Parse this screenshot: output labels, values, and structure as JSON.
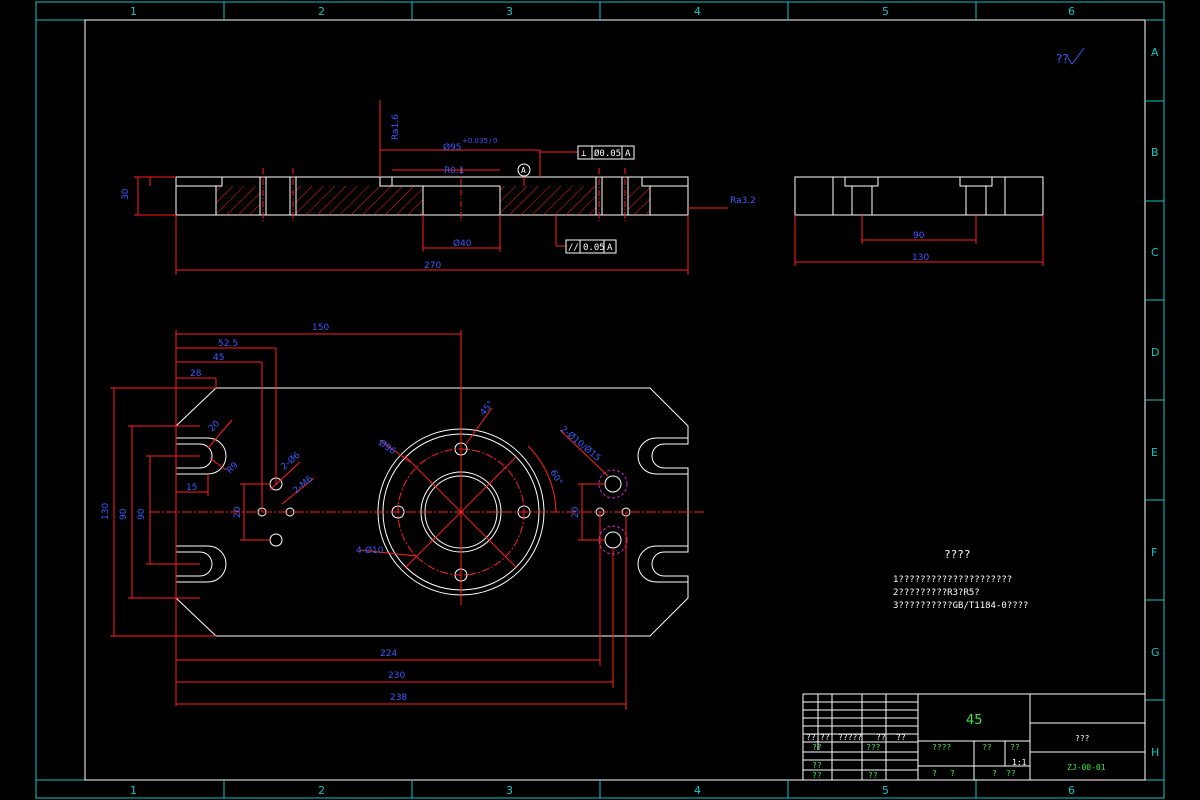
{
  "zones": {
    "columns": [
      "1",
      "2",
      "3",
      "4",
      "5",
      "6"
    ],
    "rows": [
      "A",
      "B",
      "C",
      "D",
      "E",
      "F",
      "G",
      "H"
    ]
  },
  "roughness": {
    "symbol_text": "??",
    "top_right": "??"
  },
  "front_view": {
    "dims": {
      "height": "30",
      "overall": "270",
      "bore": "Ø40",
      "bore_spec": "Ø95",
      "bore_tol": "+0.035 / 0",
      "depth_note": "R0.1",
      "surface_note": "Ra1.6",
      "flatness_note": "Ra3.2"
    },
    "datum": "A",
    "fcf_perp": {
      "sym": "⊥",
      "tol": "Ø0.05",
      "datum": "A"
    },
    "fcf_par": {
      "sym": "//",
      "tol": "0.05",
      "datum": "A"
    }
  },
  "side_view": {
    "dims": {
      "inner": "90",
      "overall": "130"
    }
  },
  "top_view": {
    "dims": {
      "d150": "150",
      "d52": "52.5",
      "d45": "45",
      "d28": "28",
      "d15": "15",
      "d20": "20",
      "r_slot": "R9",
      "h130": "130",
      "h90a": "90",
      "h90b": "90",
      "h20": "20",
      "h20b": "20",
      "d224": "224",
      "d230": "230",
      "d238": "238",
      "holes_small": "2-Ø6",
      "holes_m6": "2-M6",
      "pcd": "Ø96",
      "holes_big": "4-Ø10",
      "angle": "45°",
      "counterbore": "2-Ø10/Ø15",
      "ang2": "60°"
    }
  },
  "tech_req": {
    "title": "????",
    "lines": [
      "1?????????????????????",
      "2?????????R3?R5?",
      "3??????????GB/T1184-0????"
    ]
  },
  "title_block": {
    "material": "45",
    "name": "???",
    "drawing_no": "ZJ-00-01",
    "ratio": "1:1",
    "left_rows": [
      [
        "??",
        "??",
        "?????",
        "??",
        "??"
      ],
      [
        "??",
        "",
        "???",
        "",
        ""
      ],
      [
        "??",
        "",
        "",
        "",
        ""
      ],
      [
        "??",
        "",
        "??",
        "",
        ""
      ]
    ],
    "mid_row": [
      "????",
      "??",
      "??"
    ],
    "bottom_row": [
      "?",
      "?",
      "?",
      "??"
    ]
  },
  "colors": {
    "border": "#13c6c6",
    "part": "#ffffff",
    "dim_line": "#ff2020",
    "dim_text": "#3c5cff",
    "title_text": "#3be83b",
    "highlight": "#d020d0"
  }
}
